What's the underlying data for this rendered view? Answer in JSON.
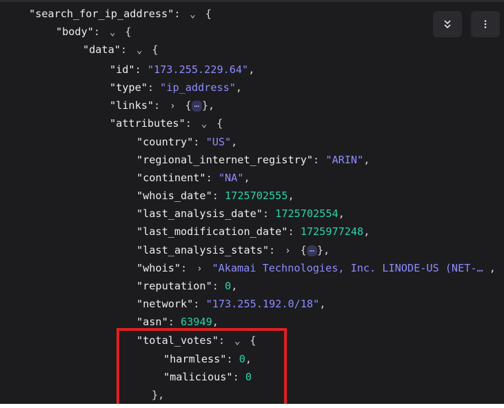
{
  "toolbar": {
    "collapse_all_icon": "double-chevron-down-icon",
    "more_icon": "vertical-ellipsis-icon"
  },
  "json": {
    "root_key": "\"search_for_ip_address\"",
    "body_key": "\"body\"",
    "data_key": "\"data\"",
    "id_key": "\"id\"",
    "id_value": "\"173.255.229.64\"",
    "type_key": "\"type\"",
    "type_value": "\"ip_address\"",
    "links_key": "\"links\"",
    "attributes_key": "\"attributes\"",
    "country_key": "\"country\"",
    "country_value": "\"US\"",
    "rir_key": "\"regional_internet_registry\"",
    "rir_value": "\"ARIN\"",
    "continent_key": "\"continent\"",
    "continent_value": "\"NA\"",
    "whois_date_key": "\"whois_date\"",
    "whois_date_value": "1725702555",
    "last_analysis_date_key": "\"last_analysis_date\"",
    "last_analysis_date_value": "1725702554",
    "last_modification_date_key": "\"last_modification_date\"",
    "last_modification_date_value": "1725977248",
    "last_analysis_stats_key": "\"last_analysis_stats\"",
    "whois_key": "\"whois\"",
    "whois_value": "\"Akamai Technologies, Inc. LINODE-US (NET-…",
    "reputation_key": "\"reputation\"",
    "reputation_value": "0",
    "network_key": "\"network\"",
    "network_value": "\"173.255.192.0/18\"",
    "asn_key": "\"asn\"",
    "asn_value": "63949",
    "total_votes_key": "\"total_votes\"",
    "harmless_key": "\"harmless\"",
    "harmless_value": "0",
    "malicious_key": "\"malicious\"",
    "malicious_value": "0",
    "ellipsis": "⋯"
  },
  "colors": {
    "background": "#1c1c1f",
    "string": "#8e8cff",
    "number": "#2fd3a8",
    "highlight": "#e02020"
  }
}
